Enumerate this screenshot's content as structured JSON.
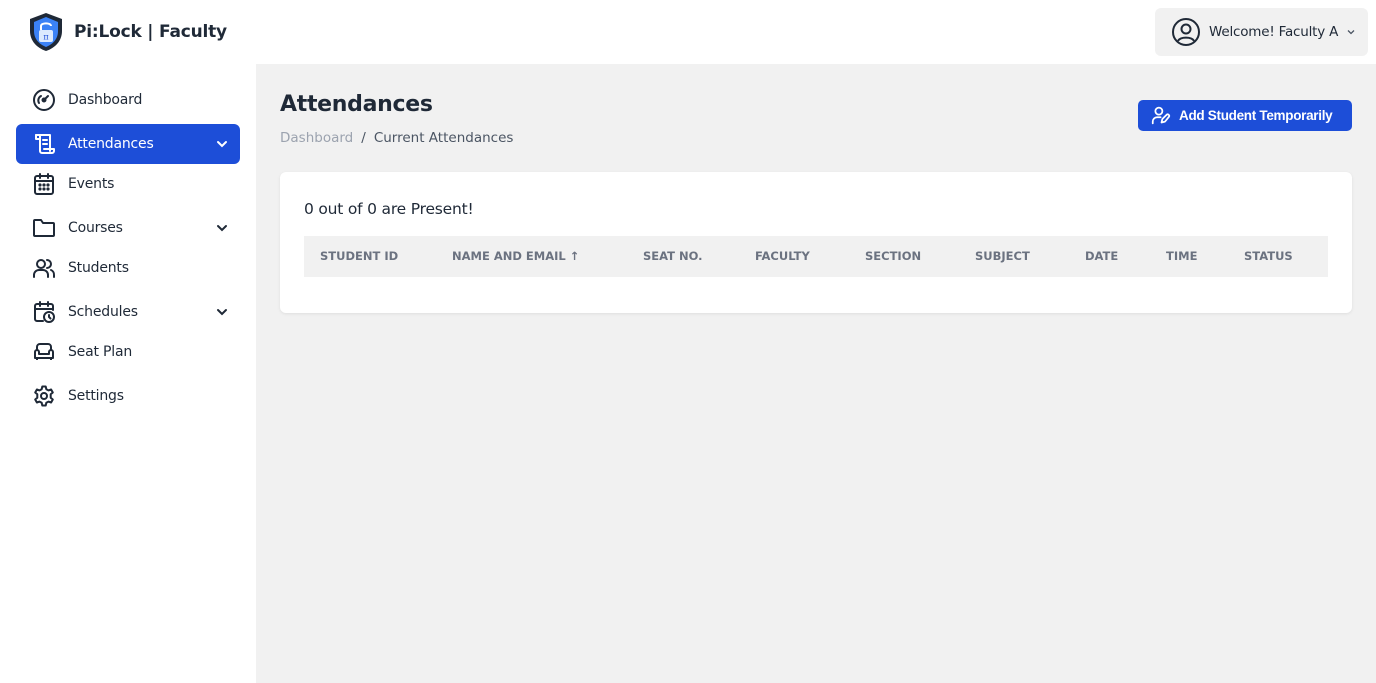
{
  "header": {
    "brand": "Pi:Lock | Faculty",
    "welcome": "Welcome! Faculty A",
    "user_icon": "user-circle-icon",
    "menu_icon": "chevron-down-icon"
  },
  "sidebar": {
    "items": [
      {
        "label": "Dashboard",
        "icon": "gauge-icon"
      },
      {
        "label": "Attendances",
        "icon": "scroll-icon",
        "active": true,
        "expandable": true
      },
      {
        "label": "Events",
        "icon": "calendar-icon"
      },
      {
        "label": "Courses",
        "icon": "folder-icon",
        "expandable": true
      },
      {
        "label": "Students",
        "icon": "users-icon"
      },
      {
        "label": "Schedules",
        "icon": "calendar-clock-icon",
        "expandable": true
      },
      {
        "label": "Seat Plan",
        "icon": "sofa-icon"
      },
      {
        "label": "Settings",
        "icon": "gear-icon"
      }
    ]
  },
  "main": {
    "title": "Attendances",
    "breadcrumb": {
      "link": "Dashboard",
      "separator": "/",
      "current": "Current Attendances"
    },
    "add_button": "Add Student Temporarily",
    "summary": "0 out of 0 are Present!",
    "columns": [
      "STUDENT ID",
      "NAME AND EMAIL ↑",
      "SEAT NO.",
      "FACULTY",
      "SECTION",
      "SUBJECT",
      "DATE",
      "TIME",
      "STATUS"
    ]
  },
  "colors": {
    "accent": "#1d4ed8",
    "background": "#f1f1f1",
    "text": "#1f2937",
    "muted": "#6b7280"
  }
}
